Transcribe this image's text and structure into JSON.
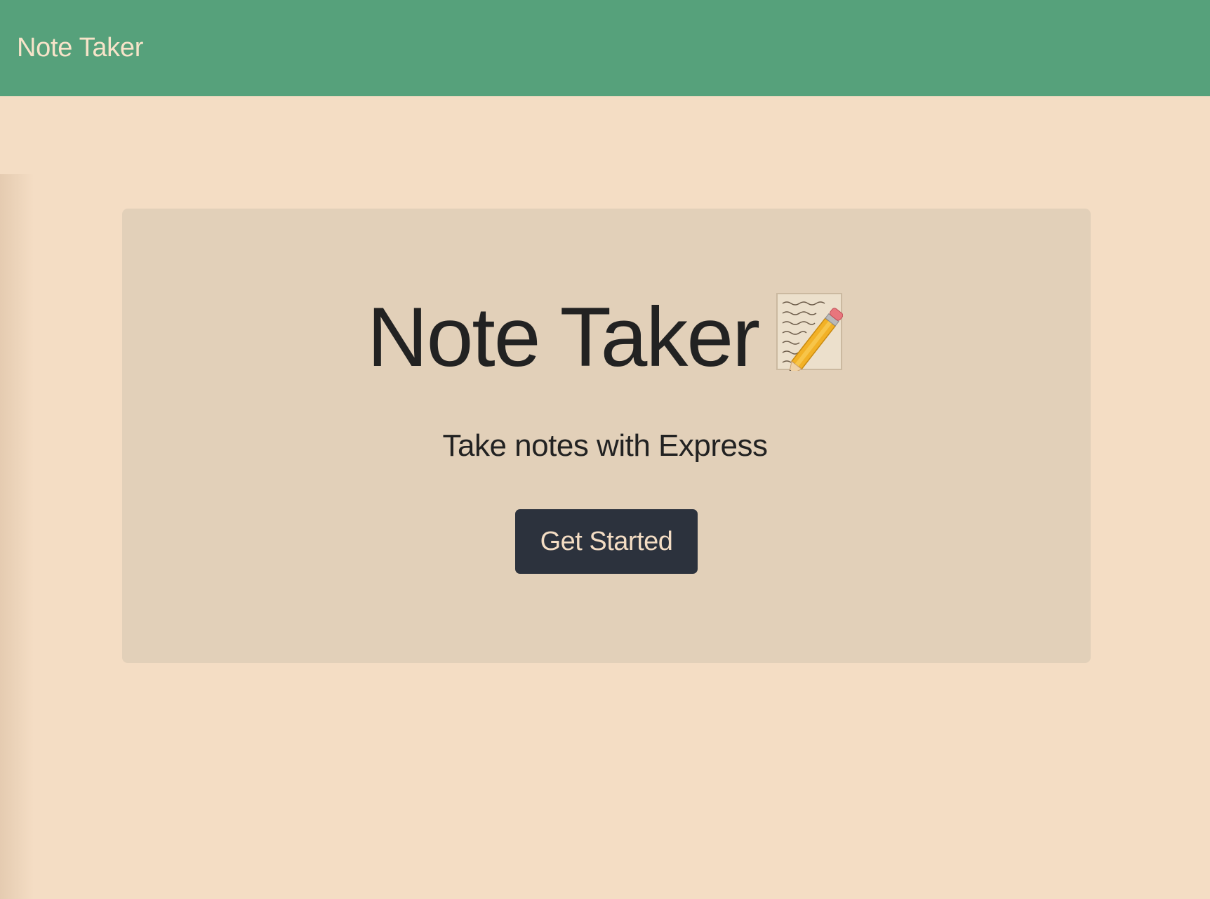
{
  "navbar": {
    "brand": "Note Taker"
  },
  "hero": {
    "title": "Note Taker",
    "title_icon": "memo-icon",
    "subtitle": "Take notes with Express",
    "cta_label": "Get Started"
  },
  "colors": {
    "navbar_bg": "#56a17b",
    "page_bg": "#f4ddc4",
    "card_bg": "#e2d0b9",
    "button_bg": "#2c323d",
    "button_text": "#f4ddc4",
    "brand_text": "#f7e3c9"
  }
}
